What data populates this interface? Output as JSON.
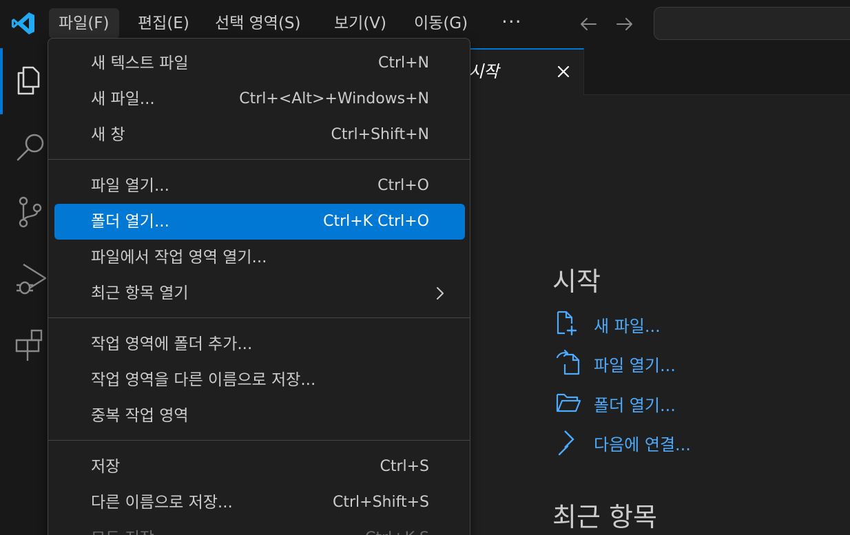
{
  "menubar": {
    "items": [
      "파일(F)",
      "편집(E)",
      "선택 영역(S)",
      "보기(V)",
      "이동(G)"
    ],
    "overflow": "···"
  },
  "tab": {
    "label": "시작"
  },
  "welcome": {
    "start_heading": "시작",
    "start_items": [
      "새 파일...",
      "파일 열기...",
      "폴더 열기...",
      "다음에 연결..."
    ],
    "recent_heading": "최근 항목"
  },
  "file_menu": {
    "items": [
      {
        "label": "새 텍스트 파일",
        "shortcut": "Ctrl+N"
      },
      {
        "label": "새 파일...",
        "shortcut": "Ctrl+<Alt>+Windows+N"
      },
      {
        "label": "새 창",
        "shortcut": "Ctrl+Shift+N"
      },
      {
        "label": "파일 열기...",
        "shortcut": "Ctrl+O"
      },
      {
        "label": "폴더 열기...",
        "shortcut": "Ctrl+K Ctrl+O"
      },
      {
        "label": "파일에서 작업 영역 열기...",
        "shortcut": ""
      },
      {
        "label": "최근 항목 열기",
        "shortcut": ""
      },
      {
        "label": "작업 영역에 폴더 추가...",
        "shortcut": ""
      },
      {
        "label": "작업 영역을 다른 이름으로 저장...",
        "shortcut": ""
      },
      {
        "label": "중복 작업 영역",
        "shortcut": ""
      },
      {
        "label": "저장",
        "shortcut": "Ctrl+S"
      },
      {
        "label": "다른 이름으로 저장...",
        "shortcut": "Ctrl+Shift+S"
      },
      {
        "label": "모두 저장",
        "shortcut": "Ctrl+K S"
      }
    ]
  },
  "colors": {
    "accent": "#0078d4",
    "link": "#4daafc",
    "background": "#1f1f1f",
    "titlebar": "#181818"
  }
}
